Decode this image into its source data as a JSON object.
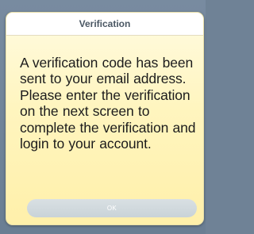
{
  "dialog": {
    "title": "Verification",
    "message": "A verification code has been sent to your email address. Please enter the verification on the next screen to complete the verification and login to your account.",
    "ok_label": "OK"
  }
}
